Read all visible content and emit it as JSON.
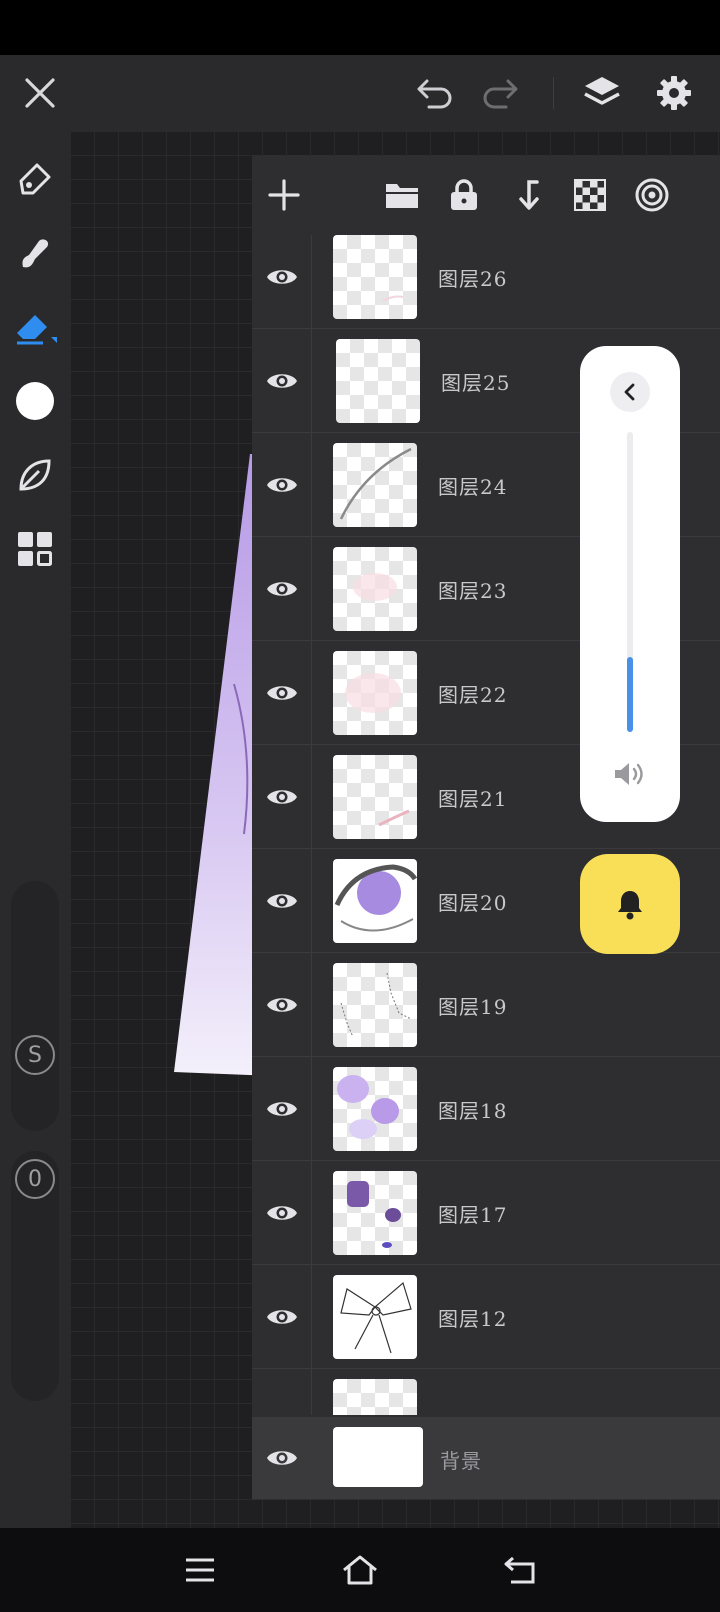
{
  "app": {
    "top_icons": [
      "close-icon",
      "undo-icon",
      "redo-icon",
      "layers-icon",
      "gear-icon"
    ]
  },
  "left_tools": {
    "items": [
      "pen-icon",
      "smudge-icon",
      "eraser-icon",
      "color-swatch",
      "leaf-icon",
      "grid-menu-icon"
    ],
    "active": "eraser-icon",
    "size_slider_label": "S",
    "opacity_slider_label": "0"
  },
  "layers_panel": {
    "toolbar": [
      "add-icon",
      "folder-icon",
      "lock-icon",
      "merge-down-icon",
      "transparency-icon",
      "target-icon"
    ],
    "layers": [
      {
        "name": "图层26"
      },
      {
        "name": "图层25"
      },
      {
        "name": "图层24"
      },
      {
        "name": "图层23"
      },
      {
        "name": "图层22"
      },
      {
        "name": "图层21"
      },
      {
        "name": "图层20"
      },
      {
        "name": "图层19"
      },
      {
        "name": "图层18"
      },
      {
        "name": "图层17"
      },
      {
        "name": "图层12"
      }
    ],
    "background_layer": {
      "name": "背景"
    }
  },
  "volume_overlay": {
    "level": 0.25,
    "accent": "#4a90e8",
    "bell_color": "#f8df57"
  },
  "navbar": [
    "menu-icon",
    "home-icon",
    "back-icon"
  ]
}
